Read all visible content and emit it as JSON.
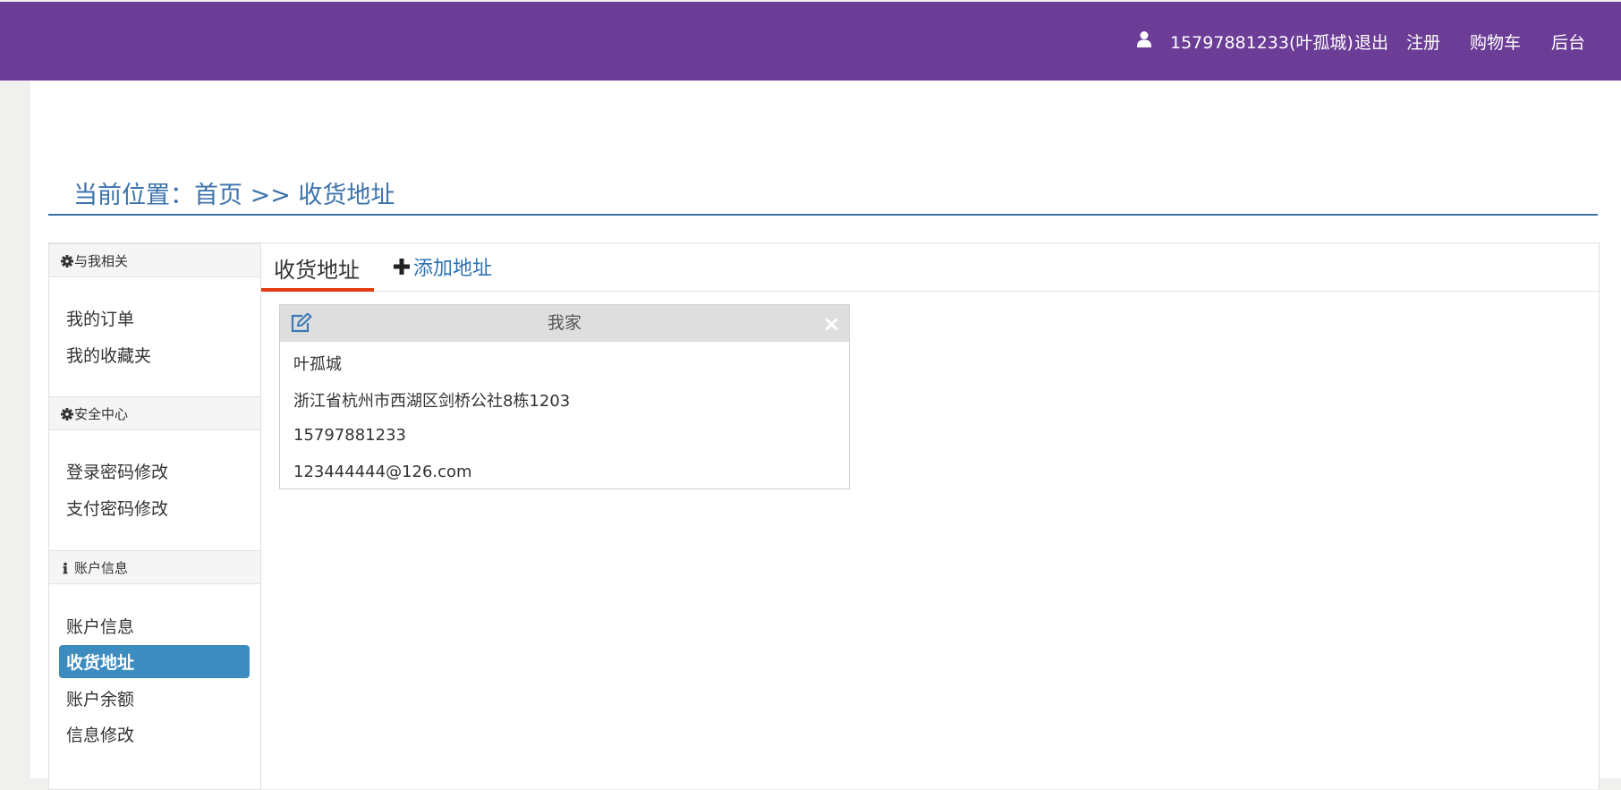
{
  "header": {
    "user": "15797881233(叶孤城)",
    "logout": "退出",
    "register": "注册",
    "cart": "购物车",
    "admin": "后台",
    "colors": {
      "bar": "#6c3d97"
    }
  },
  "breadcrumb": "当前位置：首页 >> 收货地址",
  "sidebar": {
    "sections": [
      {
        "icon": "gear-icon",
        "title": "与我相关",
        "items": [
          "我的订单",
          "我的收藏夹"
        ]
      },
      {
        "icon": "gear-icon",
        "title": "安全中心",
        "items": [
          "登录密码修改",
          "支付密码修改"
        ]
      },
      {
        "icon": "info-icon",
        "title": "账户信息",
        "items": [
          "账户信息",
          "收货地址",
          "账户余额",
          "信息修改"
        ]
      }
    ],
    "active_item": "收货地址"
  },
  "tabs": {
    "active": "收货地址",
    "add": "添加地址"
  },
  "address_card": {
    "title": "我家",
    "name": "叶孤城",
    "address": "浙江省杭州市西湖区剑桥公社8栋1203",
    "phone": "15797881233",
    "email": "123444444@126.com"
  },
  "colors": {
    "accent": "#3d8cc0",
    "link": "#3c73ab",
    "tab_underline": "#e23b10"
  }
}
